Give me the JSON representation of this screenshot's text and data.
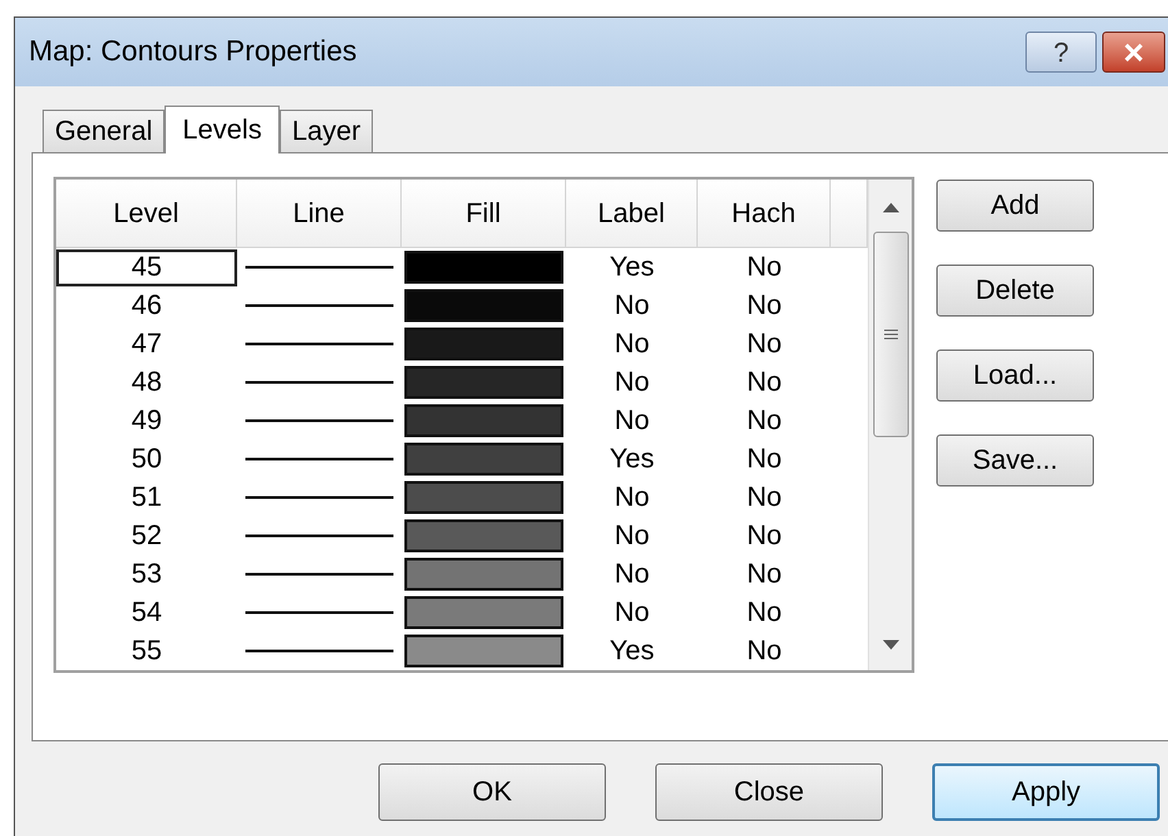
{
  "window": {
    "title": "Map: Contours Properties",
    "help": "?",
    "close": "×"
  },
  "tabs": [
    {
      "label": "General",
      "selected": false
    },
    {
      "label": "Levels",
      "selected": true
    },
    {
      "label": "Layer",
      "selected": false
    }
  ],
  "table": {
    "columns": [
      "Level",
      "Line",
      "Fill",
      "Label",
      "Hach"
    ],
    "rows": [
      {
        "level": "45",
        "color": "#000000",
        "label": "Yes",
        "hach": "No",
        "selected": true
      },
      {
        "level": "46",
        "color": "#0a0a0a",
        "label": "No",
        "hach": "No",
        "selected": false
      },
      {
        "level": "47",
        "color": "#191919",
        "label": "No",
        "hach": "No",
        "selected": false
      },
      {
        "level": "48",
        "color": "#262626",
        "label": "No",
        "hach": "No",
        "selected": false
      },
      {
        "level": "49",
        "color": "#333333",
        "label": "No",
        "hach": "No",
        "selected": false
      },
      {
        "level": "50",
        "color": "#404040",
        "label": "Yes",
        "hach": "No",
        "selected": false
      },
      {
        "level": "51",
        "color": "#4c4c4c",
        "label": "No",
        "hach": "No",
        "selected": false
      },
      {
        "level": "52",
        "color": "#595959",
        "label": "No",
        "hach": "No",
        "selected": false
      },
      {
        "level": "53",
        "color": "#737373",
        "label": "No",
        "hach": "No",
        "selected": false
      },
      {
        "level": "54",
        "color": "#7a7a7a",
        "label": "No",
        "hach": "No",
        "selected": false
      },
      {
        "level": "55",
        "color": "#8a8a8a",
        "label": "Yes",
        "hach": "No",
        "selected": false
      }
    ]
  },
  "side_buttons": [
    "Add",
    "Delete",
    "Load...",
    "Save..."
  ],
  "buttons": [
    {
      "label": "OK",
      "default": false
    },
    {
      "label": "Close",
      "default": false
    },
    {
      "label": "Apply",
      "default": true
    }
  ]
}
